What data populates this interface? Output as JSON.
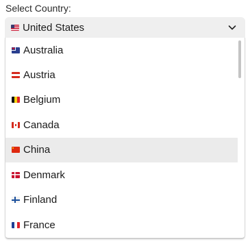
{
  "label": "Select Country:",
  "select": {
    "value": "United States",
    "flag_icon": "us-flag-icon"
  },
  "options": [
    {
      "label": "Australia",
      "flag_icon": "australia-flag-icon",
      "highlighted": false
    },
    {
      "label": "Austria",
      "flag_icon": "austria-flag-icon",
      "highlighted": false
    },
    {
      "label": "Belgium",
      "flag_icon": "belgium-flag-icon",
      "highlighted": false
    },
    {
      "label": "Canada",
      "flag_icon": "canada-flag-icon",
      "highlighted": false
    },
    {
      "label": "China",
      "flag_icon": "china-flag-icon",
      "highlighted": true
    },
    {
      "label": "Denmark",
      "flag_icon": "denmark-flag-icon",
      "highlighted": false
    },
    {
      "label": "Finland",
      "flag_icon": "finland-flag-icon",
      "highlighted": false
    },
    {
      "label": "France",
      "flag_icon": "france-flag-icon",
      "highlighted": false
    }
  ],
  "colors": {
    "select_bg": "#efefef",
    "highlight_bg": "#ebebeb",
    "scroll_thumb": "#c4c4c4"
  }
}
